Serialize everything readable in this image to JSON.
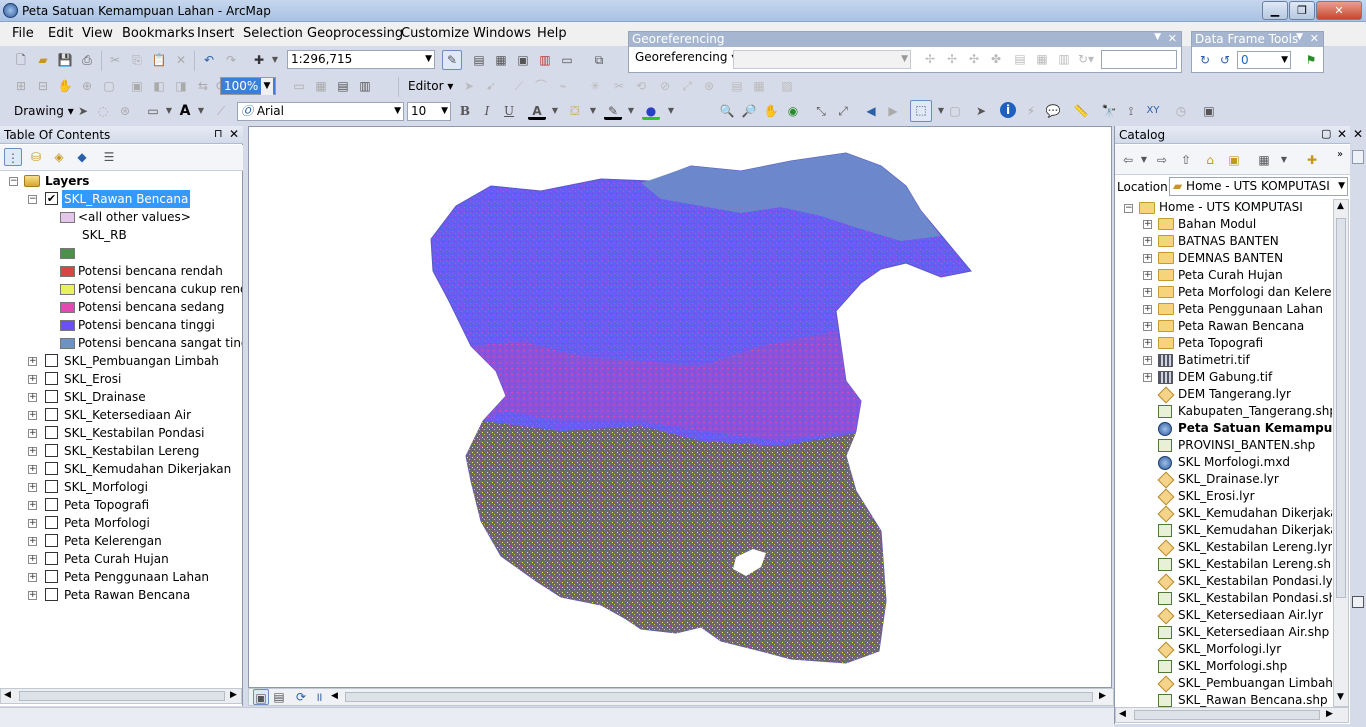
{
  "window": {
    "title": "Peta Satuan Kemampuan Lahan - ArcMap"
  },
  "menu": [
    "File",
    "Edit",
    "View",
    "Bookmarks",
    "Insert",
    "Selection",
    "Geoprocessing",
    "Customize",
    "Windows",
    "Help"
  ],
  "toolbar": {
    "scale": "1:296,715",
    "zoom_percent": "100%",
    "editor_label": "Editor",
    "drawing_label": "Drawing",
    "font_name": "Arial",
    "font_size": "10"
  },
  "georef": {
    "title": "Georeferencing",
    "dropdown": "Georeferencing",
    "layer_value": "",
    "text_value": ""
  },
  "dataframe": {
    "title": "Data Frame Tools",
    "value": "0"
  },
  "toc": {
    "title": "Table Of Contents",
    "root": "Layers",
    "active_layer": "SKL_Rawan Bencana",
    "legend_heading": "SKL_RB",
    "legend": [
      {
        "label": "<all other values>",
        "color": "#e3c6ea"
      },
      {
        "label": "",
        "color": "#4e8f4e"
      },
      {
        "label": "Potensi bencana rendah",
        "color": "#d84545"
      },
      {
        "label": "Potensi bencana cukup rendah",
        "color": "#e7f25c"
      },
      {
        "label": "Potensi bencana sedang",
        "color": "#e24aaf"
      },
      {
        "label": "Potensi bencana tinggi",
        "color": "#6a51f0"
      },
      {
        "label": "Potensi bencana sangat tinggi",
        "color": "#6c93c3"
      }
    ],
    "layers": [
      "SKL_Pembuangan Limbah",
      "SKL_Erosi",
      "SKL_Drainase",
      "SKL_Ketersediaan Air",
      "SKL_Kestabilan Pondasi",
      "SKL_Kestabilan Lereng",
      "SKL_Kemudahan Dikerjakan",
      "SKL_Morfologi",
      "Peta Topografi",
      "Peta Morfologi",
      "Peta Kelerengan",
      "Peta Curah Hujan",
      "Peta Penggunaan Lahan",
      "Peta Rawan Bencana"
    ]
  },
  "catalog": {
    "title": "Catalog",
    "location_label": "Location:",
    "location_value": "Home - UTS KOMPUTASI",
    "root": "Home - UTS KOMPUTASI",
    "items": [
      {
        "label": "Bahan Modul",
        "type": "folder"
      },
      {
        "label": "BATNAS BANTEN",
        "type": "folder"
      },
      {
        "label": "DEMNAS BANTEN",
        "type": "folder"
      },
      {
        "label": "Peta Curah Hujan",
        "type": "folder"
      },
      {
        "label": "Peta Morfologi dan Kelereng",
        "type": "folder"
      },
      {
        "label": "Peta Penggunaan Lahan",
        "type": "folder"
      },
      {
        "label": "Peta Rawan Bencana",
        "type": "folder"
      },
      {
        "label": "Peta Topografi",
        "type": "folder"
      },
      {
        "label": "Batimetri.tif",
        "type": "raster"
      },
      {
        "label": "DEM Gabung.tif",
        "type": "raster"
      },
      {
        "label": "DEM Tangerang.lyr",
        "type": "lyr"
      },
      {
        "label": "Kabupaten_Tangerang.shp",
        "type": "shp"
      },
      {
        "label": "Peta Satuan Kemampuan La",
        "type": "mxd"
      },
      {
        "label": "PROVINSI_BANTEN.shp",
        "type": "shp"
      },
      {
        "label": "SKL Morfologi.mxd",
        "type": "mxd"
      },
      {
        "label": "SKL_Drainase.lyr",
        "type": "lyr"
      },
      {
        "label": "SKL_Erosi.lyr",
        "type": "lyr"
      },
      {
        "label": "SKL_Kemudahan Dikerjakan.",
        "type": "lyr"
      },
      {
        "label": "SKL_Kemudahan Dikerjakan.",
        "type": "shp"
      },
      {
        "label": "SKL_Kestabilan Lereng.lyr",
        "type": "lyr"
      },
      {
        "label": "SKL_Kestabilan Lereng.shp",
        "type": "shp"
      },
      {
        "label": "SKL_Kestabilan Pondasi.lyr",
        "type": "lyr"
      },
      {
        "label": "SKL_Kestabilan Pondasi.shp",
        "type": "shp"
      },
      {
        "label": "SKL_Ketersediaan Air.lyr",
        "type": "lyr"
      },
      {
        "label": "SKL_Ketersediaan Air.shp",
        "type": "shp"
      },
      {
        "label": "SKL_Morfologi.lyr",
        "type": "lyr"
      },
      {
        "label": "SKL_Morfologi.shp",
        "type": "shp"
      },
      {
        "label": "SKL_Pembuangan Limbah.ly",
        "type": "lyr"
      },
      {
        "label": "SKL_Rawan Bencana.shp",
        "type": "shp"
      }
    ]
  }
}
